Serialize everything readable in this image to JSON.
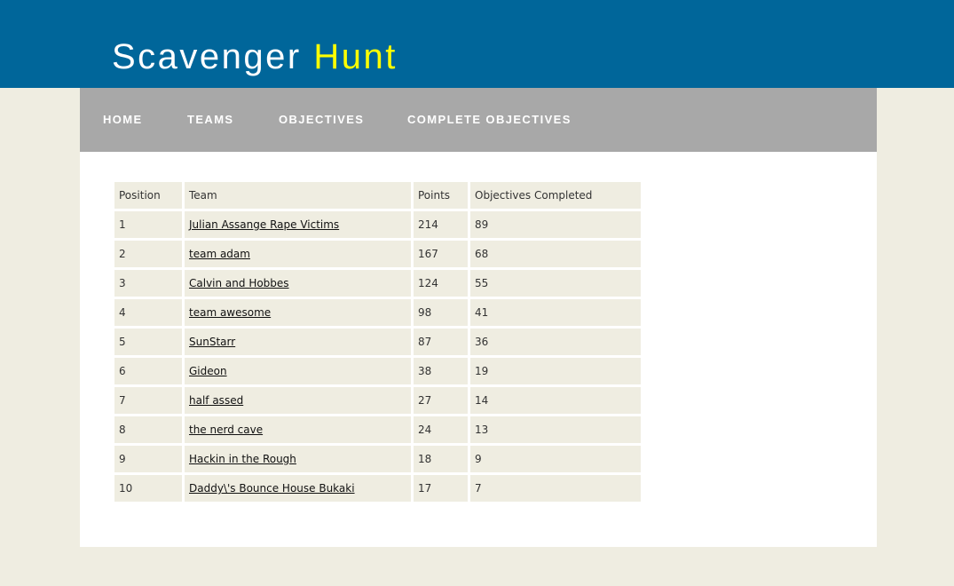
{
  "header": {
    "title_main": "Scavenger",
    "title_accent": "Hunt"
  },
  "colors": {
    "header_bg": "#00669a",
    "title_accent": "#ffff00",
    "nav_bg": "#a8a8a8",
    "page_bg": "#efede1",
    "cell_bg": "#efede1"
  },
  "nav": {
    "items": [
      {
        "label": "HOME"
      },
      {
        "label": "TEAMS"
      },
      {
        "label": "OBJECTIVES"
      },
      {
        "label": "COMPLETE OBJECTIVES"
      }
    ]
  },
  "standings": {
    "columns": [
      "Position",
      "Team",
      "Points",
      "Objectives Completed"
    ],
    "rows": [
      {
        "position": "1",
        "team": "Julian Assange Rape Victims",
        "points": "214",
        "objectives": "89"
      },
      {
        "position": "2",
        "team": "team adam",
        "points": "167",
        "objectives": "68"
      },
      {
        "position": "3",
        "team": "Calvin and Hobbes",
        "points": "124",
        "objectives": "55"
      },
      {
        "position": "4",
        "team": "team awesome",
        "points": "98",
        "objectives": "41"
      },
      {
        "position": "5",
        "team": "SunStarr",
        "points": "87",
        "objectives": "36"
      },
      {
        "position": "6",
        "team": "Gideon",
        "points": "38",
        "objectives": "19"
      },
      {
        "position": "7",
        "team": "half assed",
        "points": "27",
        "objectives": "14"
      },
      {
        "position": "8",
        "team": "the nerd cave",
        "points": "24",
        "objectives": "13"
      },
      {
        "position": "9",
        "team": "Hackin in the Rough",
        "points": "18",
        "objectives": "9"
      },
      {
        "position": "10",
        "team": "Daddy\\'s Bounce House Bukaki",
        "points": "17",
        "objectives": "7"
      }
    ]
  }
}
